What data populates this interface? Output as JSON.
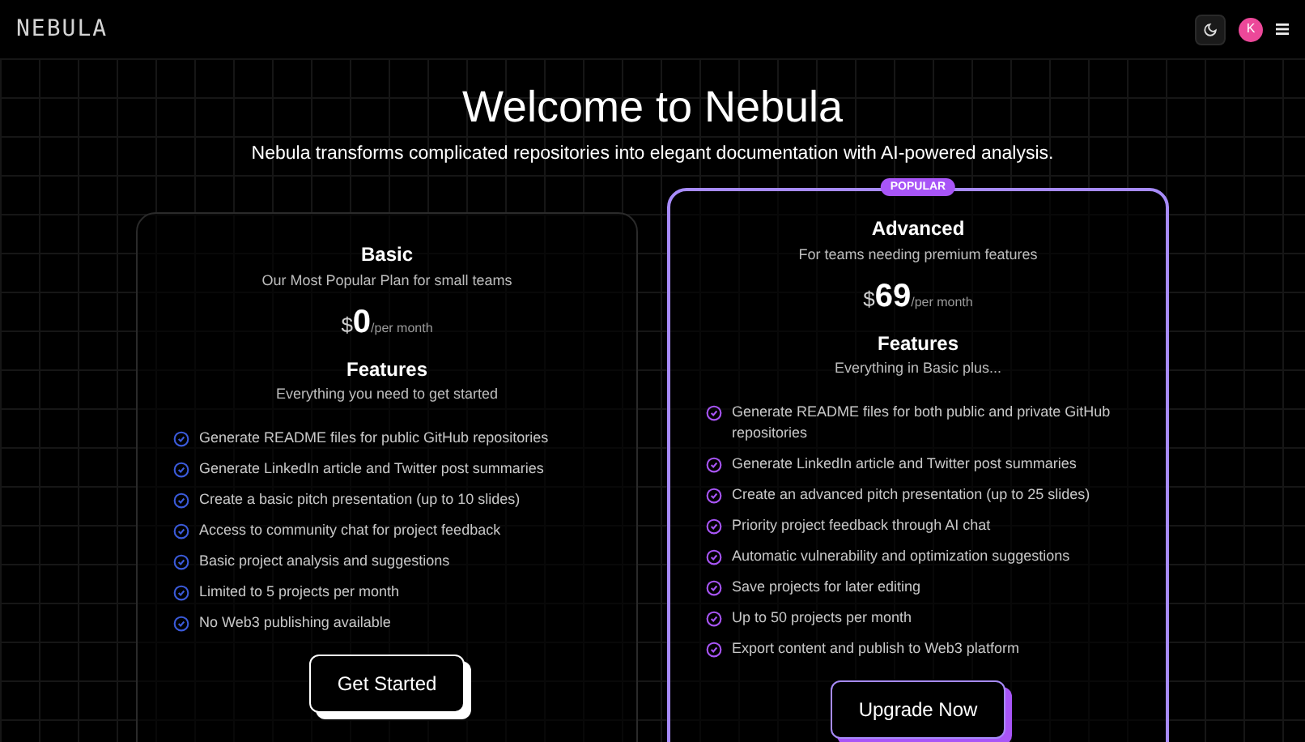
{
  "header": {
    "logo": "NEBULA",
    "avatar": "K"
  },
  "hero": {
    "title": "Welcome to Nebula",
    "subtitle": "Nebula transforms complicated repositories into elegant documentation with AI-powered analysis."
  },
  "plans": [
    {
      "name": "Basic",
      "popular": false,
      "description": "Our Most Popular Plan for small teams",
      "currency": "$",
      "price": "0",
      "period": "/per month",
      "features_title": "Features",
      "features_subtitle": "Everything you need to get started",
      "features": [
        "Generate README files for public GitHub repositories",
        "Generate LinkedIn article and Twitter post summaries",
        "Create a basic pitch presentation (up to 10 slides)",
        "Access to community chat for project feedback",
        "Basic project analysis and suggestions",
        "Limited to 5 projects per month",
        "No Web3 publishing available"
      ],
      "button": "Get Started"
    },
    {
      "name": "Advanced",
      "popular": true,
      "badge": "POPULAR",
      "description": "For teams needing premium features",
      "currency": "$",
      "price": "69",
      "period": "/per month",
      "features_title": "Features",
      "features_subtitle": "Everything in Basic plus...",
      "features": [
        "Generate README files for both public and private GitHub repositories",
        "Generate LinkedIn article and Twitter post summaries",
        "Create an advanced pitch presentation (up to 25 slides)",
        "Priority project feedback through AI chat",
        "Automatic vulnerability and optimization suggestions",
        "Save projects for later editing",
        "Up to 50 projects per month",
        "Export content and publish to Web3 platform"
      ],
      "button": "Upgrade Now"
    }
  ]
}
